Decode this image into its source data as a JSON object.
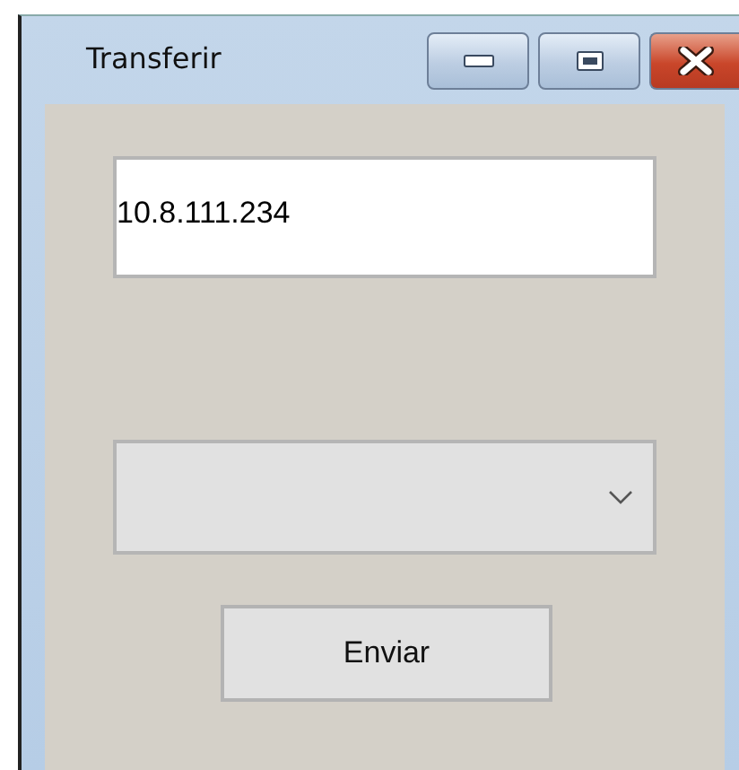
{
  "window": {
    "title": "Transferir"
  },
  "address_field": {
    "value": "10.8.111.234"
  },
  "send_button": {
    "label": "Enviar"
  }
}
